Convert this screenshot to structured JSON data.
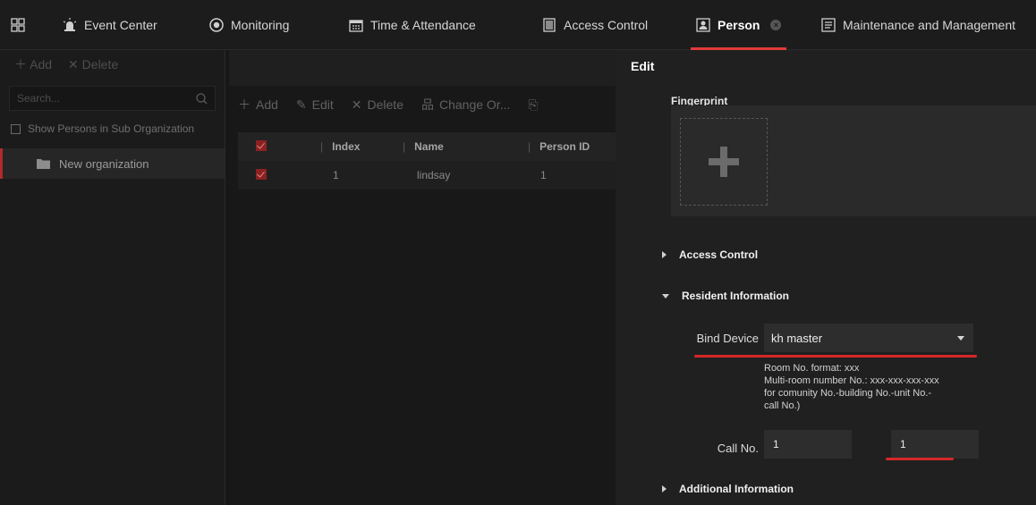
{
  "nav": {
    "items": [
      {
        "label": "Event Center"
      },
      {
        "label": "Monitoring"
      },
      {
        "label": "Time & Attendance"
      },
      {
        "label": "Access Control"
      },
      {
        "label": "Person"
      },
      {
        "label": "Maintenance and Management"
      }
    ],
    "active_index": 4,
    "accent_color": "#e23a3a"
  },
  "sidebar": {
    "add_label": "Add",
    "delete_label": "Delete",
    "search_placeholder": "Search...",
    "show_sub_label": "Show Persons in Sub Organization",
    "org_label": "New organization"
  },
  "middle": {
    "toolbar": {
      "add": "Add",
      "edit": "Edit",
      "delete": "Delete",
      "change_org": "Change Or..."
    },
    "table": {
      "headers": [
        "Index",
        "Name",
        "Person ID"
      ],
      "rows": [
        {
          "index": "1",
          "name": "lindsay",
          "person_id": "1"
        }
      ]
    }
  },
  "edit": {
    "title": "Edit",
    "fingerprint_label": "Fingerprint",
    "sections": {
      "access_control": "Access Control",
      "resident_information": "Resident Information",
      "additional_information": "Additional Information"
    },
    "bind_device_label": "Bind Device",
    "bind_device_value": "kh master",
    "hint_lines": [
      "Room No. format: xxx",
      "Multi-room number No.: xxx-xxx-xxx-xxx",
      "for comunity No.-building No.-unit No.-",
      "call No.)"
    ],
    "call_no_label": "Call No.",
    "call_no_value_1": "1",
    "call_no_value_2": "1"
  }
}
